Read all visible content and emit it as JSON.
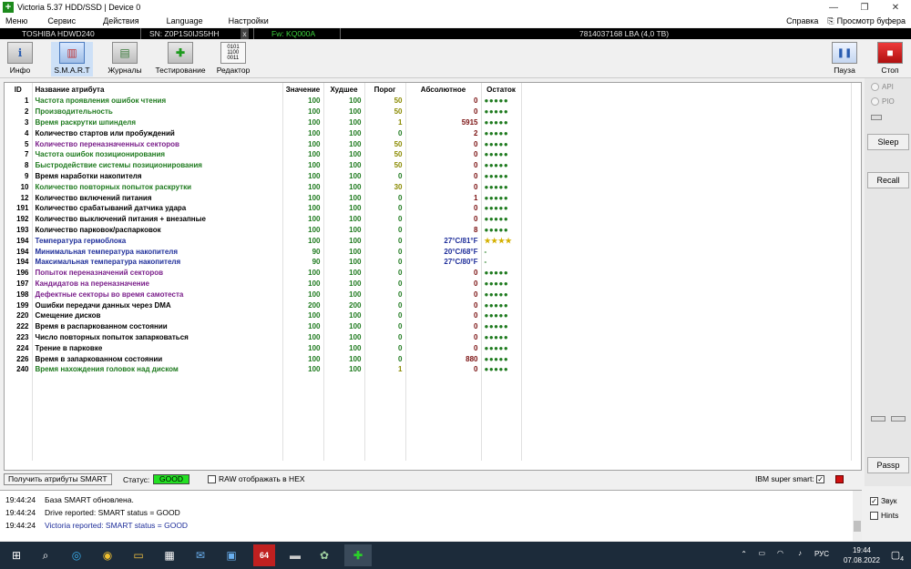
{
  "window": {
    "title": "Victoria 5.37 HDD/SSD | Device 0"
  },
  "menu": {
    "items": [
      "Меню",
      "Сервис",
      "Действия",
      "Language",
      "Настройки"
    ],
    "help": "Справка",
    "clipboard": "Просмотр буфера"
  },
  "device": {
    "model": "TOSHIBA HDWD240",
    "serial": "SN: Z0P1S0IJS5HH",
    "close": "x",
    "firmware": "Fw: KQ000A",
    "capacity": "7814037168 LBA (4,0 TB)"
  },
  "toolbar": {
    "info": "Инфо",
    "smart": "S.M.A.R.T",
    "logs": "Журналы",
    "test": "Тестирование",
    "editor": "Редактор",
    "pause": "Пауза",
    "stop": "Стоп"
  },
  "table": {
    "headers": [
      "ID",
      "Название атрибута",
      "Значение",
      "Худшее",
      "Порог",
      "Абсолютное",
      "Остаток"
    ],
    "rows": [
      {
        "id": "1",
        "name": "Частота проявления ошибок чтения",
        "val": "100",
        "worst": "100",
        "thr": "50",
        "raw": "0",
        "rem": "●●●●●",
        "nc": "n-green",
        "tc": "t-olive",
        "rc": "r-dark",
        "rm": "rem-g"
      },
      {
        "id": "2",
        "name": "Производительность",
        "val": "100",
        "worst": "100",
        "thr": "50",
        "raw": "0",
        "rem": "●●●●●",
        "nc": "n-green",
        "tc": "t-olive",
        "rc": "r-dark",
        "rm": "rem-g"
      },
      {
        "id": "3",
        "name": "Время раскрутки шпинделя",
        "val": "100",
        "worst": "100",
        "thr": "1",
        "raw": "5915",
        "rem": "●●●●●",
        "nc": "n-green",
        "tc": "t-olive",
        "rc": "r-dark",
        "rm": "rem-g"
      },
      {
        "id": "4",
        "name": "Количество стартов или пробуждений",
        "val": "100",
        "worst": "100",
        "thr": "0",
        "raw": "2",
        "rem": "●●●●●",
        "nc": "n-black",
        "tc": "t-green",
        "rc": "r-dark",
        "rm": "rem-g"
      },
      {
        "id": "5",
        "name": "Количество переназначенных секторов",
        "val": "100",
        "worst": "100",
        "thr": "50",
        "raw": "0",
        "rem": "●●●●●",
        "nc": "n-purple",
        "tc": "t-olive",
        "rc": "r-dark",
        "rm": "rem-g"
      },
      {
        "id": "7",
        "name": "Частота ошибок позиционирования",
        "val": "100",
        "worst": "100",
        "thr": "50",
        "raw": "0",
        "rem": "●●●●●",
        "nc": "n-green",
        "tc": "t-olive",
        "rc": "r-dark",
        "rm": "rem-g"
      },
      {
        "id": "8",
        "name": "Быстродействие системы позиционирования",
        "val": "100",
        "worst": "100",
        "thr": "50",
        "raw": "0",
        "rem": "●●●●●",
        "nc": "n-green",
        "tc": "t-olive",
        "rc": "r-dark",
        "rm": "rem-g"
      },
      {
        "id": "9",
        "name": "Время наработки накопителя",
        "val": "100",
        "worst": "100",
        "thr": "0",
        "raw": "0",
        "rem": "●●●●●",
        "nc": "n-black",
        "tc": "t-green",
        "rc": "r-dark",
        "rm": "rem-g"
      },
      {
        "id": "10",
        "name": "Количество повторных попыток раскрутки",
        "val": "100",
        "worst": "100",
        "thr": "30",
        "raw": "0",
        "rem": "●●●●●",
        "nc": "n-green",
        "tc": "t-olive",
        "rc": "r-dark",
        "rm": "rem-g"
      },
      {
        "id": "12",
        "name": "Количество включений питания",
        "val": "100",
        "worst": "100",
        "thr": "0",
        "raw": "1",
        "rem": "●●●●●",
        "nc": "n-black",
        "tc": "t-green",
        "rc": "r-dark",
        "rm": "rem-g"
      },
      {
        "id": "191",
        "name": "Количество срабатываний датчика удара",
        "val": "100",
        "worst": "100",
        "thr": "0",
        "raw": "0",
        "rem": "●●●●●",
        "nc": "n-black",
        "tc": "t-green",
        "rc": "r-dark",
        "rm": "rem-g"
      },
      {
        "id": "192",
        "name": "Количество выключений питания + внезапные",
        "val": "100",
        "worst": "100",
        "thr": "0",
        "raw": "0",
        "rem": "●●●●●",
        "nc": "n-black",
        "tc": "t-green",
        "rc": "r-dark",
        "rm": "rem-g"
      },
      {
        "id": "193",
        "name": "Количество парковок/распарковок",
        "val": "100",
        "worst": "100",
        "thr": "0",
        "raw": "8",
        "rem": "●●●●●",
        "nc": "n-black",
        "tc": "t-green",
        "rc": "r-dark",
        "rm": "rem-g"
      },
      {
        "id": "194",
        "name": "Температура гермоблока",
        "val": "100",
        "worst": "100",
        "thr": "0",
        "raw": "27°C/81°F",
        "rem": "★★★★",
        "nc": "n-blue",
        "tc": "t-green",
        "rc": "r-blue",
        "rm": "rem-y"
      },
      {
        "id": "194",
        "name": "Минимальная температура накопителя",
        "val": "90",
        "worst": "100",
        "thr": "0",
        "raw": "20°C/68°F",
        "rem": "-",
        "nc": "n-blue",
        "tc": "t-green",
        "rc": "r-blue",
        "rm": "rem-g"
      },
      {
        "id": "194",
        "name": "Максимальная температура накопителя",
        "val": "90",
        "worst": "100",
        "thr": "0",
        "raw": "27°C/80°F",
        "rem": "-",
        "nc": "n-blue",
        "tc": "t-green",
        "rc": "r-blue",
        "rm": "rem-g"
      },
      {
        "id": "196",
        "name": "Попыток переназначений секторов",
        "val": "100",
        "worst": "100",
        "thr": "0",
        "raw": "0",
        "rem": "●●●●●",
        "nc": "n-purple",
        "tc": "t-green",
        "rc": "r-dark",
        "rm": "rem-g"
      },
      {
        "id": "197",
        "name": "Кандидатов на переназначение",
        "val": "100",
        "worst": "100",
        "thr": "0",
        "raw": "0",
        "rem": "●●●●●",
        "nc": "n-purple",
        "tc": "t-green",
        "rc": "r-dark",
        "rm": "rem-g"
      },
      {
        "id": "198",
        "name": "Дефектные секторы во время самотеста",
        "val": "100",
        "worst": "100",
        "thr": "0",
        "raw": "0",
        "rem": "●●●●●",
        "nc": "n-purple",
        "tc": "t-green",
        "rc": "r-dark",
        "rm": "rem-g"
      },
      {
        "id": "199",
        "name": "Ошибки передачи данных через DMA",
        "val": "200",
        "worst": "200",
        "thr": "0",
        "raw": "0",
        "rem": "●●●●●",
        "nc": "n-black",
        "tc": "t-green",
        "rc": "r-dark",
        "rm": "rem-g"
      },
      {
        "id": "220",
        "name": "Смещение дисков",
        "val": "100",
        "worst": "100",
        "thr": "0",
        "raw": "0",
        "rem": "●●●●●",
        "nc": "n-black",
        "tc": "t-green",
        "rc": "r-dark",
        "rm": "rem-g"
      },
      {
        "id": "222",
        "name": "Время в распаркованном состоянии",
        "val": "100",
        "worst": "100",
        "thr": "0",
        "raw": "0",
        "rem": "●●●●●",
        "nc": "n-black",
        "tc": "t-green",
        "rc": "r-dark",
        "rm": "rem-g"
      },
      {
        "id": "223",
        "name": "Число повторных попыток запарковаться",
        "val": "100",
        "worst": "100",
        "thr": "0",
        "raw": "0",
        "rem": "●●●●●",
        "nc": "n-black",
        "tc": "t-green",
        "rc": "r-dark",
        "rm": "rem-g"
      },
      {
        "id": "224",
        "name": "Трение в парковке",
        "val": "100",
        "worst": "100",
        "thr": "0",
        "raw": "0",
        "rem": "●●●●●",
        "nc": "n-black",
        "tc": "t-green",
        "rc": "r-dark",
        "rm": "rem-g"
      },
      {
        "id": "226",
        "name": "Время в запаркованном состоянии",
        "val": "100",
        "worst": "100",
        "thr": "0",
        "raw": "880",
        "rem": "●●●●●",
        "nc": "n-black",
        "tc": "t-green",
        "rc": "r-dark",
        "rm": "rem-g"
      },
      {
        "id": "240",
        "name": "Время нахождения головок над диском",
        "val": "100",
        "worst": "100",
        "thr": "1",
        "raw": "0",
        "rem": "●●●●●",
        "nc": "n-green",
        "tc": "t-olive",
        "rc": "r-dark",
        "rm": "rem-g"
      }
    ]
  },
  "right_panel": {
    "api": "API",
    "pio": "PIO",
    "sleep": "Sleep",
    "recall": "Recall",
    "passp": "Passp"
  },
  "status": {
    "get_button": "Получить атрибуты SMART",
    "status_label": "Статус:",
    "status_value": "GOOD",
    "raw_hex": "RAW отображать в HEX",
    "ibm": "IBM super smart:"
  },
  "log": [
    {
      "time": "19:44:24",
      "text": "База SMART обновлена.",
      "color": "#000000"
    },
    {
      "time": "19:44:24",
      "text": "Drive reported: SMART status = GOOD",
      "color": "#000000"
    },
    {
      "time": "19:44:24",
      "text": "Victoria reported: SMART status = GOOD",
      "color": "#1e2e9a"
    }
  ],
  "log_options": {
    "sound": "Звук",
    "hints": "Hints"
  },
  "taskbar": {
    "lang": "РУС",
    "time": "19:44",
    "date": "07.08.2022",
    "notif": "4",
    "badge64": "64"
  }
}
